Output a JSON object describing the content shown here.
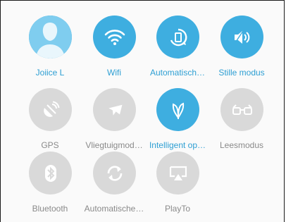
{
  "tiles": [
    {
      "label": "Joiice L",
      "state": "on",
      "icon": "avatar-icon"
    },
    {
      "label": "Wifi",
      "state": "on",
      "icon": "wifi-icon"
    },
    {
      "label": "Automatisch…",
      "state": "on",
      "icon": "auto-rotate-icon"
    },
    {
      "label": "Stille modus",
      "state": "on",
      "icon": "speaker-mute-icon"
    },
    {
      "label": "GPS",
      "state": "off",
      "icon": "gps-icon"
    },
    {
      "label": "Vliegtuigmod…",
      "state": "off",
      "icon": "airplane-icon"
    },
    {
      "label": "Intelligent op…",
      "state": "on",
      "icon": "leaf-icon"
    },
    {
      "label": "Leesmodus",
      "state": "off",
      "icon": "reading-glasses-icon"
    },
    {
      "label": "Bluetooth",
      "state": "off",
      "icon": "bluetooth-icon"
    },
    {
      "label": "Automatische…",
      "state": "off",
      "icon": "sync-icon"
    },
    {
      "label": "PlayTo",
      "state": "off",
      "icon": "playto-icon"
    }
  ],
  "colors": {
    "on": "#3eaee0",
    "off": "#d9d9d9",
    "label_on": "#2e9fd3",
    "label_off": "#8a8a8a"
  }
}
